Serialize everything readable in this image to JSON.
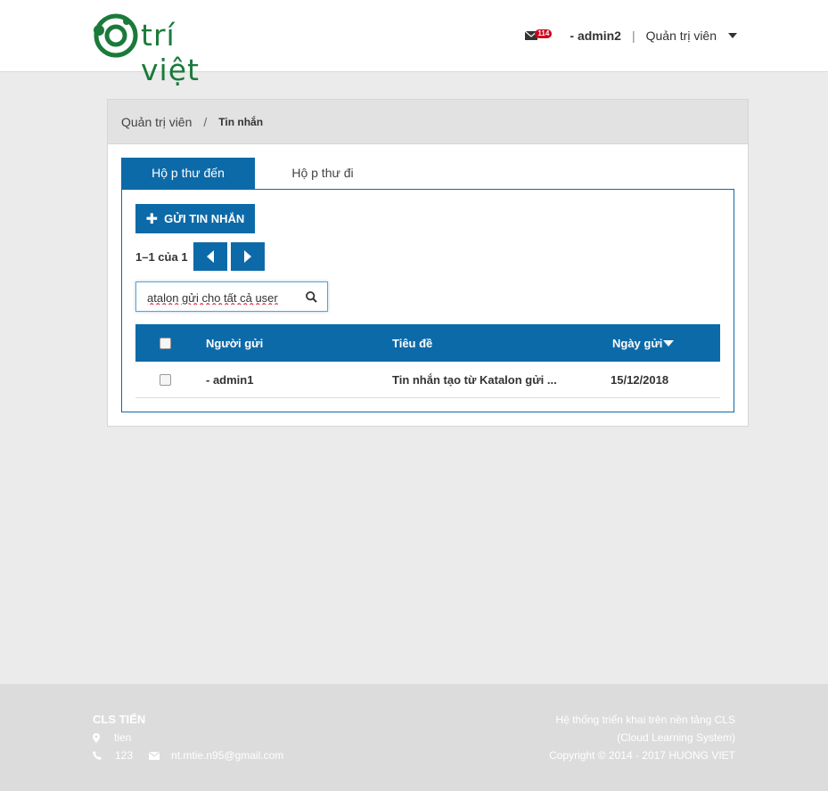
{
  "header": {
    "logo_text": "trí việt",
    "mail_count": "114",
    "username": "- admin2",
    "separator": "|",
    "role": "Quản trị viên"
  },
  "breadcrumb": {
    "root": "Quản trị viên",
    "separator": "/",
    "current": "Tin nhắn"
  },
  "tabs": [
    {
      "label": "Hộ p thư đến",
      "active": true
    },
    {
      "label": "Hộ p thư đi",
      "active": false
    }
  ],
  "actions": {
    "send_label": "GỬI TIN NHẮN"
  },
  "pager": {
    "text": "1–1 của 1"
  },
  "search": {
    "value": "atalon gửi cho tất cả user"
  },
  "table": {
    "columns": [
      "Người gửi",
      "Tiêu đề",
      "Ngày gửi"
    ],
    "rows": [
      {
        "sender": "- admin1",
        "subject": "Tin nhắn tạo từ Katalon gửi ...",
        "date": "15/12/2018"
      }
    ]
  },
  "footer": {
    "title": "CLS TIẾN",
    "address": "tien",
    "phone": "123",
    "email": "nt.mtie.n95@gmail.com",
    "right_line1": "Hệ thống triển khai trên nền tảng CLS",
    "right_line2": "(Cloud Learning System)",
    "right_line3": "Copyright © 2014 - 2017 HUONG VIET"
  },
  "colors": {
    "primary": "#0d6aa8",
    "brand_green": "#1b7a3a",
    "badge_red": "#d0021b",
    "footer_bg": "#dcdcdc",
    "page_bg": "#ebebeb"
  },
  "icons": [
    "logo-icon",
    "mail-icon",
    "caret-down-icon",
    "plus-icon",
    "chevron-left-icon",
    "chevron-right-icon",
    "search-icon",
    "sort-down-icon",
    "map-marker-icon",
    "phone-icon",
    "envelope-icon"
  ]
}
